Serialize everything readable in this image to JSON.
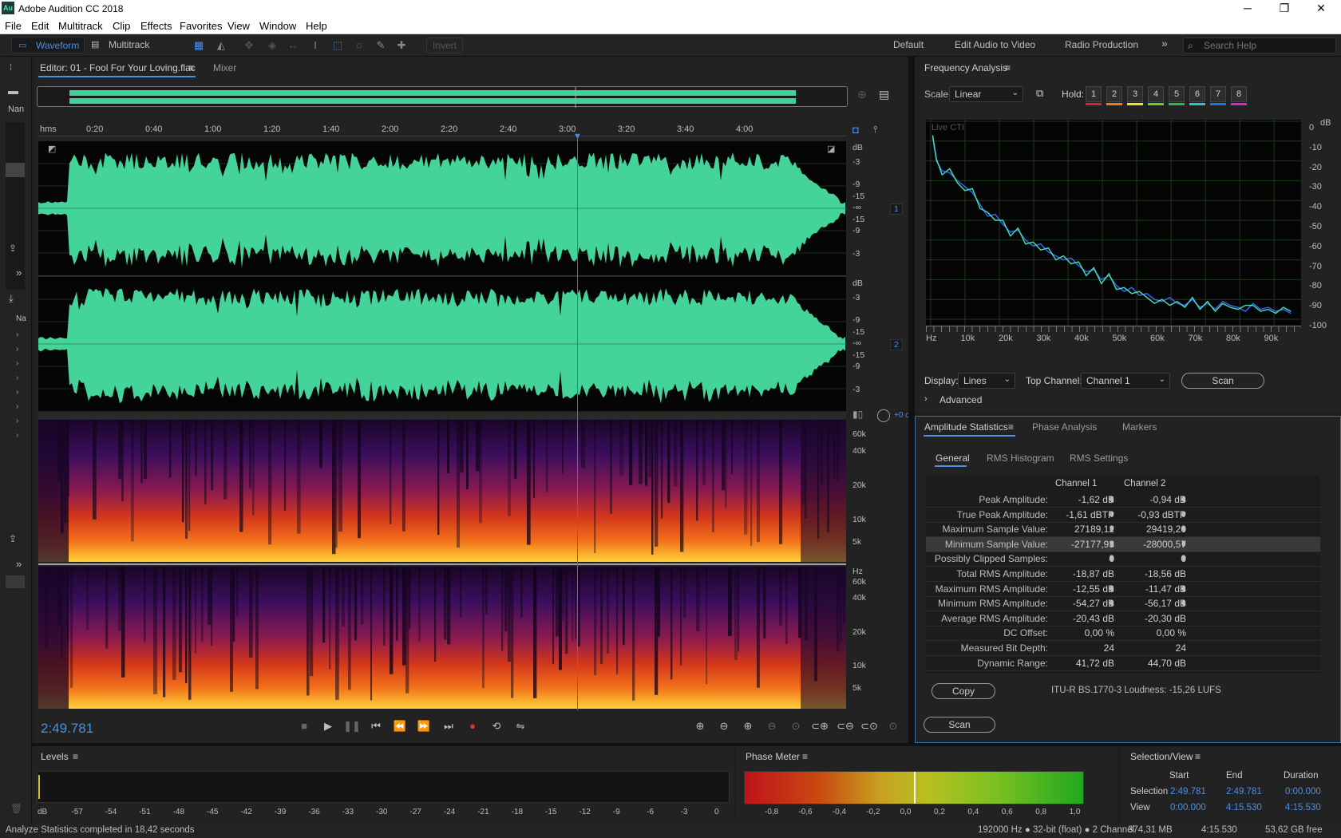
{
  "window": {
    "app_title": "Adobe Audition CC 2018",
    "logo_text": "Au",
    "minimize": "─",
    "maximize": "❐",
    "close": "✕"
  },
  "menu": [
    "File",
    "Edit",
    "Multitrack",
    "Clip",
    "Effects",
    "Favorites",
    "View",
    "Window",
    "Help"
  ],
  "toolbar": {
    "waveform_label": "Waveform",
    "multitrack_label": "Multitrack",
    "invert_label": "Invert",
    "workspaces": [
      "Default",
      "Edit Audio to Video",
      "Radio Production"
    ],
    "overflow": "»",
    "search_placeholder": "Search Help"
  },
  "left_strip": {
    "nan_label": "Nan",
    "na_label": "Na",
    "collapse": "»"
  },
  "editor": {
    "tab_label": "Editor: 01 - Fool For Your Loving.flac",
    "mixer_label": "Mixer",
    "ruler_unit": "hms",
    "ruler_ticks": [
      "0:20",
      "0:40",
      "1:00",
      "1:20",
      "1:40",
      "2:00",
      "2:20",
      "2:40",
      "3:00",
      "3:20",
      "3:40",
      "4:00"
    ],
    "db_label": "dB",
    "db_ticks_ch": [
      "-3",
      "-9",
      "-15",
      "-∞",
      "-15",
      "-9",
      "-3"
    ],
    "channel1": "1",
    "channel2": "2",
    "hz_label": "Hz",
    "spectro_ticks": [
      "60k",
      "40k",
      "20k",
      "10k",
      "5k"
    ],
    "pan_readout": "+0 c",
    "playhead_fraction": 0.667
  },
  "transport": {
    "timecode": "2:49.781"
  },
  "frequency_analysis": {
    "title": "Frequency Analysis",
    "scale_label": "Scale:",
    "scale_value": "Linear",
    "hold_label": "Hold:",
    "hold_buttons": [
      "1",
      "2",
      "3",
      "4",
      "5",
      "6",
      "7",
      "8"
    ],
    "hold_colors": [
      "#e0202a",
      "#f07820",
      "#f0e020",
      "#6ad020",
      "#20c040",
      "#20c8d0",
      "#2070e0",
      "#e020e0"
    ],
    "live_cti": "Live CTI",
    "display_label": "Display:",
    "display_value": "Lines",
    "top_channel_label": "Top Channel:",
    "top_channel_value": "Channel 1",
    "scan_label": "Scan",
    "advanced_label": "Advanced",
    "chart_data": {
      "type": "line",
      "x_unit": "Hz",
      "x_ticks": [
        "Hz",
        "10k",
        "20k",
        "30k",
        "40k",
        "50k",
        "60k",
        "70k",
        "80k",
        "90k"
      ],
      "y_unit": "dB",
      "y_ticks": [
        "0",
        "-10",
        "-20",
        "-30",
        "-40",
        "-50",
        "-60",
        "-70",
        "-80",
        "-90",
        "-100"
      ],
      "xlim": [
        0,
        96000
      ],
      "ylim": [
        -100,
        0
      ],
      "series": [
        {
          "color": "#3a66ff",
          "x": [
            500,
            1500,
            3000,
            5000,
            7000,
            9000,
            11000,
            13000,
            15000,
            17000,
            19000,
            21000,
            23000,
            25000,
            27000,
            29000,
            31000,
            33000,
            35000,
            37000,
            39000,
            41000,
            43000,
            45000,
            47000,
            49000,
            51000,
            53000,
            55000,
            57000,
            59000,
            61000,
            63000,
            65000,
            67000,
            69000,
            71000,
            73000,
            75000,
            77000,
            79000,
            81000,
            83000,
            85000,
            87000,
            89000,
            91000,
            93000,
            95000
          ],
          "values": [
            -8,
            -20,
            -25,
            -26,
            -30,
            -33,
            -36,
            -42,
            -48,
            -47,
            -52,
            -56,
            -55,
            -60,
            -63,
            -62,
            -66,
            -68,
            -70,
            -69,
            -73,
            -76,
            -75,
            -80,
            -78,
            -83,
            -86,
            -84,
            -88,
            -87,
            -90,
            -91,
            -89,
            -92,
            -93,
            -90,
            -94,
            -92,
            -95,
            -91,
            -93,
            -94,
            -96,
            -92,
            -95,
            -94,
            -96,
            -95,
            -97
          ]
        },
        {
          "color": "#44e0b0",
          "x": [
            500,
            1500,
            3000,
            5000,
            7000,
            9000,
            11000,
            13000,
            15000,
            17000,
            19000,
            21000,
            23000,
            25000,
            27000,
            29000,
            31000,
            33000,
            35000,
            37000,
            39000,
            41000,
            43000,
            45000,
            47000,
            49000,
            51000,
            53000,
            55000,
            57000,
            59000,
            61000,
            63000,
            65000,
            67000,
            69000,
            71000,
            73000,
            75000,
            77000,
            79000,
            81000,
            83000,
            85000,
            87000,
            89000,
            91000,
            93000,
            95000
          ],
          "values": [
            -7,
            -19,
            -27,
            -24,
            -31,
            -35,
            -34,
            -44,
            -46,
            -50,
            -50,
            -58,
            -54,
            -62,
            -61,
            -65,
            -64,
            -70,
            -68,
            -72,
            -71,
            -78,
            -74,
            -82,
            -77,
            -85,
            -84,
            -87,
            -86,
            -89,
            -92,
            -90,
            -93,
            -91,
            -94,
            -89,
            -95,
            -91,
            -96,
            -92,
            -94,
            -95,
            -93,
            -93,
            -96,
            -95,
            -97,
            -94,
            -96
          ]
        }
      ]
    }
  },
  "amplitude_statistics": {
    "tabs": [
      "Amplitude Statistics",
      "Phase Analysis",
      "Markers"
    ],
    "subtabs": [
      "General",
      "RMS Histogram",
      "RMS Settings"
    ],
    "col1": "Channel 1",
    "col2": "Channel 2",
    "rows": [
      {
        "label": "Peak Amplitude:",
        "c1": "-1,62 dB",
        "c2": "-0,94 dB",
        "pin": true
      },
      {
        "label": "True Peak Amplitude:",
        "c1": "-1,61 dBTP",
        "c2": "-0,93 dBTP",
        "pin": true
      },
      {
        "label": "Maximum Sample Value:",
        "c1": "27189,12",
        "c2": "29419,20",
        "pin": true
      },
      {
        "label": "Minimum Sample Value:",
        "c1": "-27177,93",
        "c2": "-28000,57",
        "pin": true
      },
      {
        "label": "Possibly Clipped Samples:",
        "c1": "0",
        "c2": "0",
        "pin": true
      },
      {
        "label": "Total RMS Amplitude:",
        "c1": "-18,87 dB",
        "c2": "-18,56 dB",
        "pin": false
      },
      {
        "label": "Maximum RMS Amplitude:",
        "c1": "-12,55 dB",
        "c2": "-11,47 dB",
        "pin": true
      },
      {
        "label": "Minimum RMS Amplitude:",
        "c1": "-54,27 dB",
        "c2": "-56,17 dB",
        "pin": true
      },
      {
        "label": "Average RMS Amplitude:",
        "c1": "-20,43 dB",
        "c2": "-20,30 dB",
        "pin": false
      },
      {
        "label": "DC Offset:",
        "c1": "0,00 %",
        "c2": "0,00 %",
        "pin": false
      },
      {
        "label": "Measured Bit Depth:",
        "c1": "24",
        "c2": "24",
        "pin": false
      },
      {
        "label": "Dynamic Range:",
        "c1": "41,72 dB",
        "c2": "44,70 dB",
        "pin": false
      }
    ],
    "copy_label": "Copy",
    "loudness_text": "ITU-R BS.1770-3 Loudness: -15,26 LUFS",
    "scan_label": "Scan"
  },
  "levels": {
    "title": "Levels",
    "ticks": [
      "dB",
      "-57",
      "-54",
      "-51",
      "-48",
      "-45",
      "-42",
      "-39",
      "-36",
      "-33",
      "-30",
      "-27",
      "-24",
      "-21",
      "-18",
      "-15",
      "-12",
      "-9",
      "-6",
      "-3",
      "0"
    ]
  },
  "phase_meter": {
    "title": "Phase Meter",
    "ticks": [
      "-0,8",
      "-0,6",
      "-0,4",
      "-0,2",
      "0,0",
      "0,2",
      "0,4",
      "0,6",
      "0,8",
      "1,0"
    ]
  },
  "selection_view": {
    "title": "Selection/View",
    "headers": [
      "Start",
      "End",
      "Duration"
    ],
    "rows": [
      {
        "label": "Selection",
        "start": "2:49.781",
        "end": "2:49.781",
        "duration": "0:00.000"
      },
      {
        "label": "View",
        "start": "0:00.000",
        "end": "4:15.530",
        "duration": "4:15.530"
      }
    ]
  },
  "status": {
    "left": "Analyze Statistics completed in 18,42 seconds",
    "format": "192000 Hz ● 32-bit (float) ● 2 Channel",
    "size": "374,31 MB",
    "duration": "4:15.530",
    "free": "53,62 GB free"
  }
}
